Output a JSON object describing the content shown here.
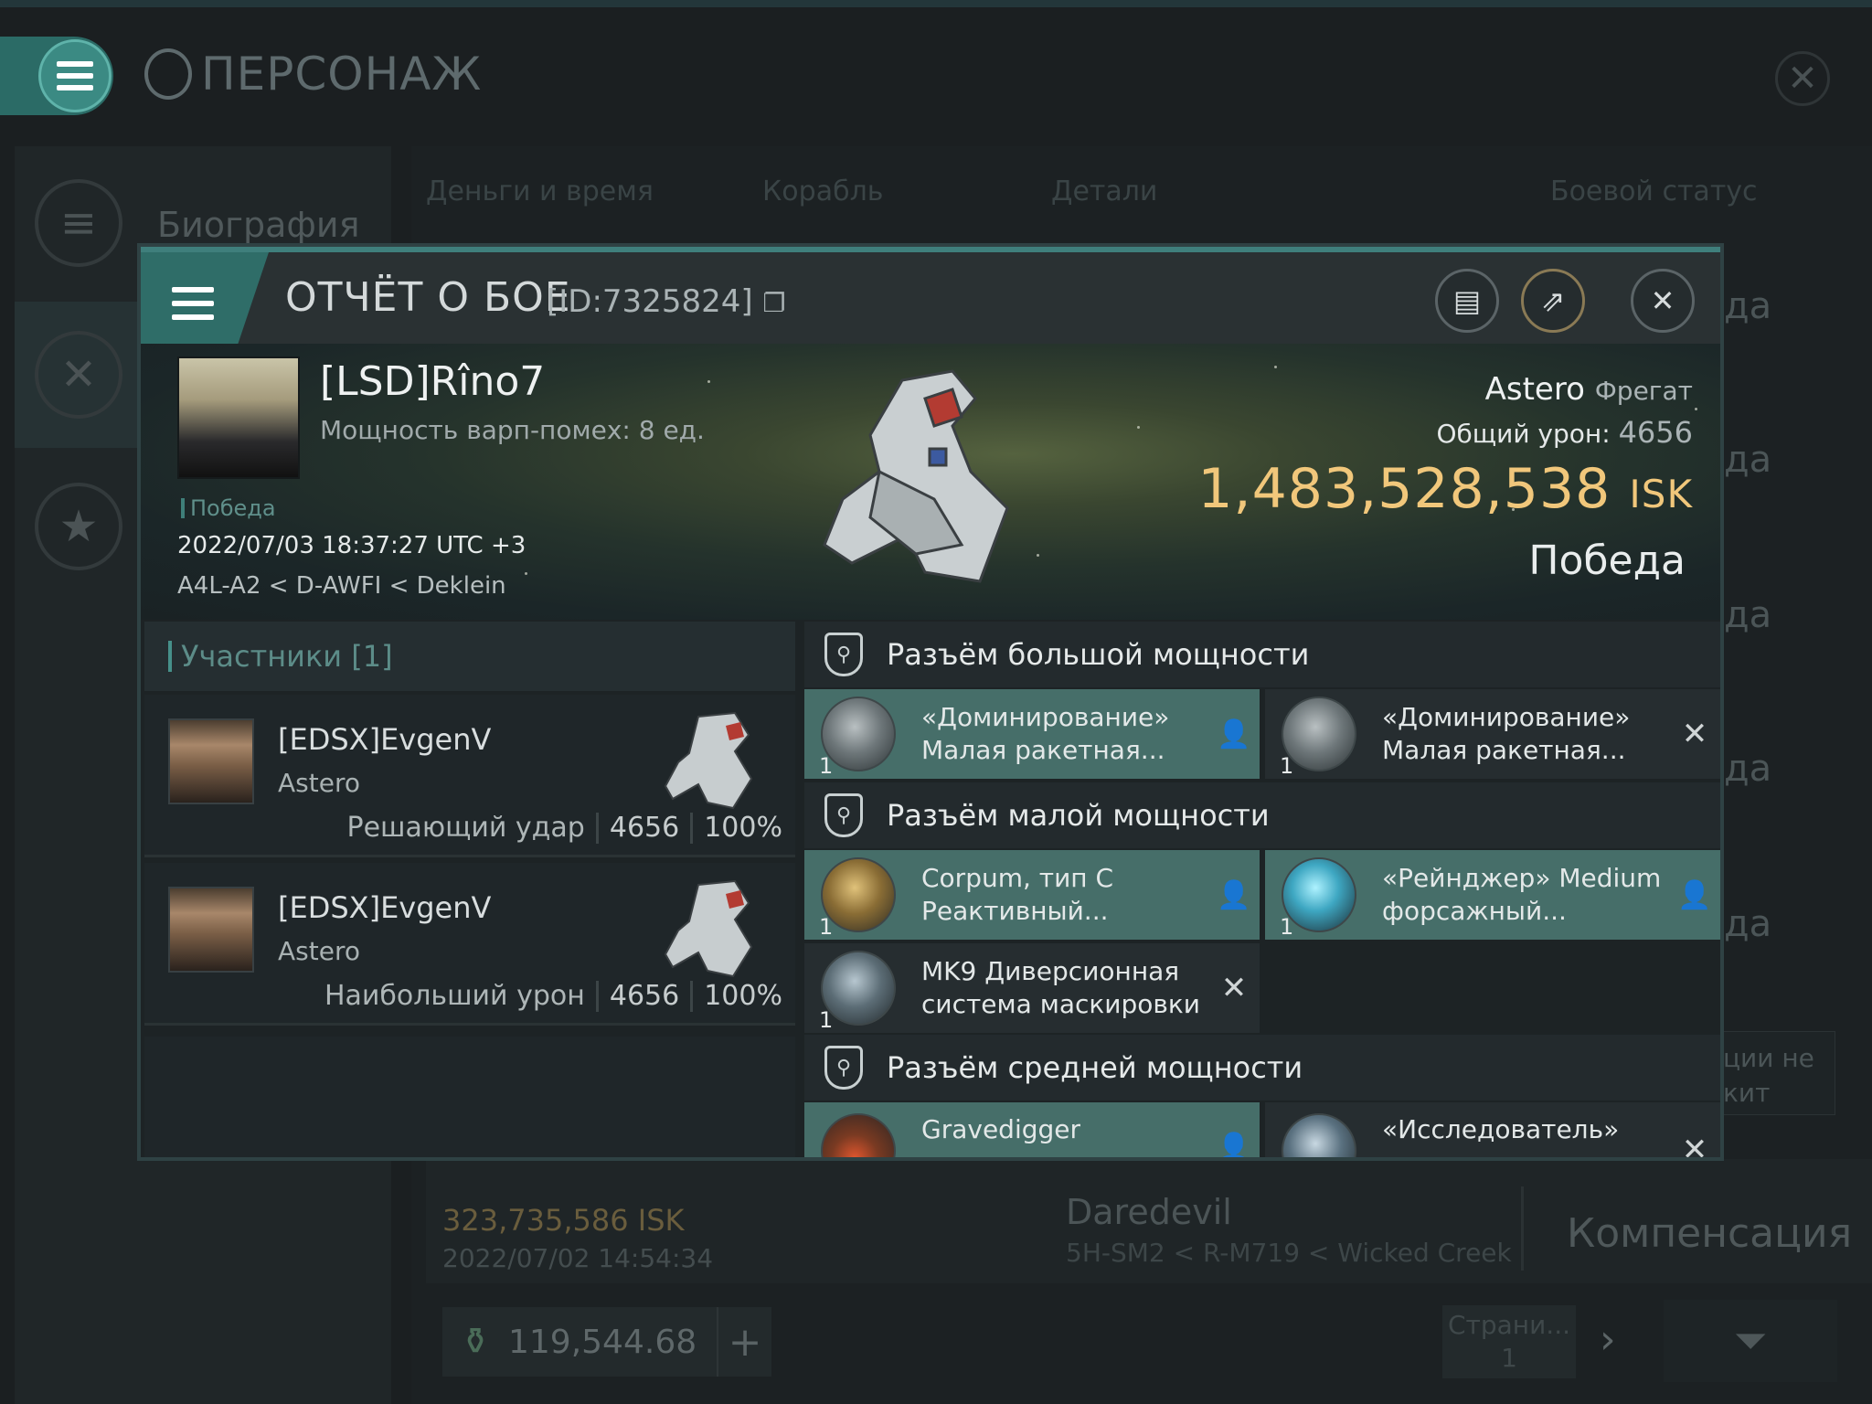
{
  "app": {
    "page_title": "ПЕРСОНАЖ",
    "sidebar": {
      "biography_label": "Биография"
    },
    "tabs": [
      "Деньги и время",
      "Корабль",
      "Детали",
      "Боевой статус"
    ],
    "status_values": [
      "да",
      "да",
      "да",
      "да",
      "да"
    ],
    "side_note": "ции не\nкит",
    "row": {
      "isk": "323,735,586  ISK",
      "date": "2022/07/02  14:54:34",
      "ship": "Daredevil",
      "location": "5H-SM2 < R-M719 < Wicked Creek",
      "action": "Компенсация"
    },
    "wallet": {
      "value": "119,544.68"
    },
    "pagination": {
      "label": "Страни...",
      "page": "1"
    }
  },
  "report": {
    "title": "ОТЧЁТ О БОЕ",
    "id": "[ID:7325824]",
    "victim": {
      "name": "[LSD]Rîno7",
      "warp_disruption": "Мощность варп-помех: 8 ед.",
      "result_small": "Победа",
      "datetime": "2022/07/03 18:37:27 UTC +3",
      "location": "A4L-A2 < D-AWFI < Deklein"
    },
    "ship": {
      "name": "Astero",
      "class": "Фрегат",
      "damage_label": "Общий урон:",
      "damage_value": "4656",
      "isk_value": "1,483,528,538",
      "isk_unit": "ISK",
      "result": "Победа"
    },
    "participants": {
      "header": "Участники [1]",
      "items": [
        {
          "name": "[EDSX]EvgenV",
          "ship": "Astero",
          "role": "Решающий удар",
          "damage": "4656",
          "percent": "100%"
        },
        {
          "name": "[EDSX]EvgenV",
          "ship": "Astero",
          "role": "Наибольший урон",
          "damage": "4656",
          "percent": "100%"
        }
      ]
    },
    "slots": {
      "high": {
        "title": "Разъём большой мощности",
        "modules": [
          {
            "name": "«Доминирование»\nМалая ракетная...",
            "qty": "1",
            "state": "dropped"
          },
          {
            "name": "«Доминирование»\nМалая ракетная...",
            "qty": "1",
            "state": "destroyed"
          }
        ]
      },
      "low": {
        "title": "Разъём малой мощности",
        "modules": [
          {
            "name": "Corpum, тип C\nРеактивный...",
            "qty": "1",
            "state": "dropped"
          },
          {
            "name": "«Рейнджер» Medium\nфорсажный...",
            "qty": "1",
            "state": "dropped"
          },
          {
            "name": "MK9 Диверсионная\nсистема маскировки",
            "qty": "1",
            "state": "destroyed"
          }
        ]
      },
      "mid": {
        "title": "Разъём средней мощности",
        "modules": [
          {
            "name": "Gravedigger",
            "qty": "1",
            "state": "dropped"
          },
          {
            "name": "«Исследователь»",
            "qty": "1",
            "state": "destroyed"
          }
        ]
      }
    }
  }
}
